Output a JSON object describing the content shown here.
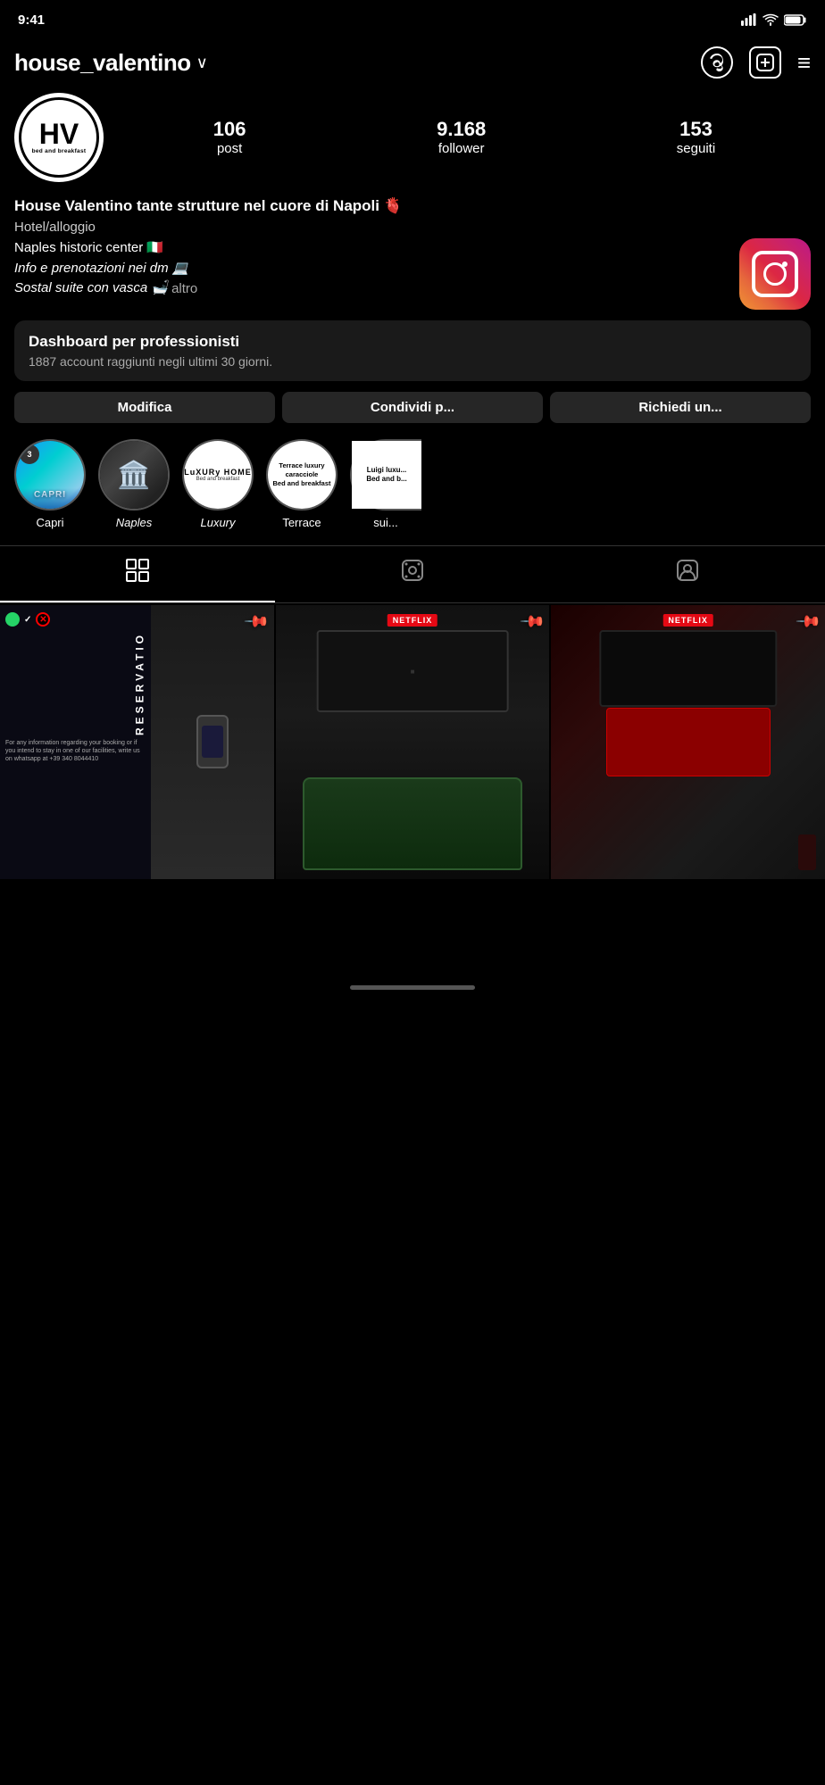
{
  "statusBar": {
    "time": "9:41"
  },
  "header": {
    "username": "house_valentino",
    "chevron": "∨",
    "threads_label": "Threads icon",
    "add_label": "Add icon",
    "menu_label": "Menu icon"
  },
  "stats": {
    "posts_count": "106",
    "posts_label": "post",
    "followers_count": "9.168",
    "followers_label": "follower",
    "following_count": "153",
    "following_label": "seguiti"
  },
  "bio": {
    "name": "House Valentino tante strutture nel cuore di Napoli 🫀",
    "category": "Hotel/alloggio",
    "line1": "Naples historic center 🇮🇹",
    "line2": "Info e prenotazioni nei dm 💻",
    "line3": "Sostal suite con vasca 🛁",
    "altro": "altro"
  },
  "dashboard": {
    "title": "Dashboard per professionisti",
    "subtitle": "1887 account raggiunti negli ultimi 30 giorni."
  },
  "buttons": {
    "edit": "Modifica",
    "share": "Condividi p...",
    "request": "Richiedi un..."
  },
  "highlights": [
    {
      "label": "Capri",
      "style": "capri",
      "badge": "3"
    },
    {
      "label": "Naples",
      "style": "naples",
      "italic": true
    },
    {
      "label": "Luxury",
      "style": "luxury",
      "italic": true
    },
    {
      "label": "Terrace",
      "style": "terrace"
    },
    {
      "label": "sui...",
      "style": "luigi"
    }
  ],
  "tabs": [
    {
      "icon": "grid",
      "label": "Posts",
      "active": true
    },
    {
      "icon": "reels",
      "label": "Reels",
      "active": false
    },
    {
      "icon": "tagged",
      "label": "Tagged",
      "active": false
    }
  ],
  "posts": [
    {
      "id": "post-1",
      "type": "reservation",
      "pinned": true
    },
    {
      "id": "post-2",
      "type": "bathtub",
      "pinned": true,
      "netflix": "NETFLIX"
    },
    {
      "id": "post-3",
      "type": "room",
      "pinned": true,
      "netflix": "NETFLIX"
    }
  ]
}
